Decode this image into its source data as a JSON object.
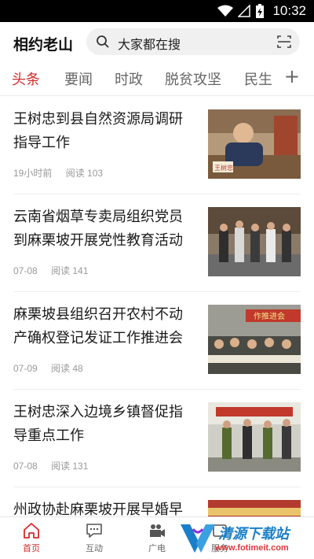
{
  "status_bar": {
    "time": "10:32"
  },
  "header": {
    "app_title": "相约老山",
    "search_placeholder": "大家都在搜"
  },
  "tabs": [
    {
      "label": "头条",
      "active": true
    },
    {
      "label": "要闻",
      "active": false
    },
    {
      "label": "时政",
      "active": false
    },
    {
      "label": "脱贫攻坚",
      "active": false
    },
    {
      "label": "民生",
      "active": false
    }
  ],
  "tab_add_label": "+",
  "news": [
    {
      "title": "王树忠到县自然资源局调研指导工作",
      "date": "19小时前",
      "reads": "阅读 103",
      "thumb_caption": "王树忠"
    },
    {
      "title": "云南省烟草专卖局组织党员到麻栗坡开展党性教育活动",
      "date": "07-08",
      "reads": "阅读 141"
    },
    {
      "title": "麻栗坡县组织召开农村不动产确权登记发证工作推进会",
      "date": "07-09",
      "reads": "阅读 48",
      "thumb_caption": "作推进会"
    },
    {
      "title": "王树忠深入边境乡镇督促指导重点工作",
      "date": "07-08",
      "reads": "阅读 131"
    },
    {
      "title": "州政协赴麻栗坡开展早婚早"
    }
  ],
  "bottom_nav": [
    {
      "label": "首页",
      "icon": "home-icon",
      "active": true
    },
    {
      "label": "互动",
      "icon": "chat-icon",
      "active": false
    },
    {
      "label": "广电",
      "icon": "video-camera-icon",
      "active": false
    },
    {
      "label": "服务",
      "icon": "service-icon",
      "active": false
    }
  ],
  "watermark": {
    "text": "清源下载站",
    "url": "www.fotimeit.com"
  },
  "colors": {
    "accent": "#d52b2b",
    "text": "#1a1a1a",
    "meta": "#999999"
  }
}
